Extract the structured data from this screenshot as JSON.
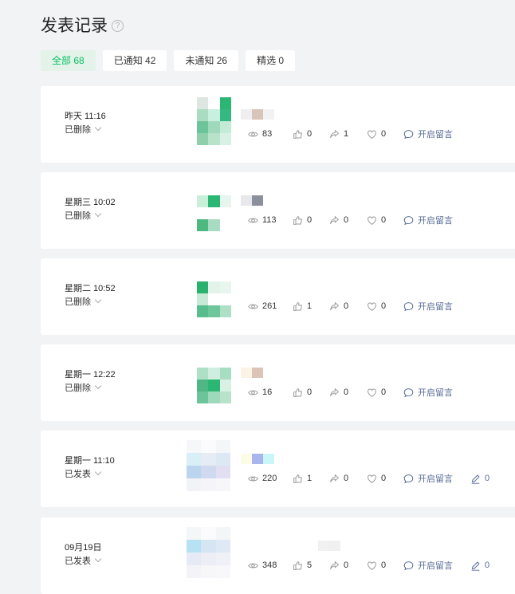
{
  "page": {
    "title": "发表记录"
  },
  "filters": [
    {
      "label": "全部 68",
      "active": true
    },
    {
      "label": "已通知 42",
      "active": false
    },
    {
      "label": "未通知 26",
      "active": false
    },
    {
      "label": "精选 0",
      "active": false
    }
  ],
  "records": [
    {
      "time": "昨天 11:16",
      "status": "已删除",
      "views": "83",
      "likes": "0",
      "shares": "1",
      "favorites": "0",
      "comment_label": "开启留言",
      "edits": null
    },
    {
      "time": "星期三 10:02",
      "status": "已删除",
      "views": "113",
      "likes": "0",
      "shares": "0",
      "favorites": "0",
      "comment_label": "开启留言",
      "edits": null
    },
    {
      "time": "星期二 10:52",
      "status": "已删除",
      "views": "261",
      "likes": "1",
      "shares": "0",
      "favorites": "0",
      "comment_label": "开启留言",
      "edits": null
    },
    {
      "time": "星期一 12:22",
      "status": "已删除",
      "views": "16",
      "likes": "0",
      "shares": "0",
      "favorites": "0",
      "comment_label": "开启留言",
      "edits": null
    },
    {
      "time": "星期一 11:10",
      "status": "已发表",
      "views": "220",
      "likes": "1",
      "shares": "0",
      "favorites": "0",
      "comment_label": "开启留言",
      "edits": "0"
    },
    {
      "time": "09月19日",
      "status": "已发表",
      "views": "348",
      "likes": "5",
      "shares": "0",
      "favorites": "0",
      "comment_label": "开启留言",
      "edits": "0"
    }
  ],
  "icons": {
    "views": "eye-icon",
    "likes": "thumb-up-icon",
    "shares": "share-icon",
    "favorites": "heart-icon",
    "comments": "comment-icon",
    "edits": "pencil-icon",
    "help": "help-icon",
    "status": "chevron-down-icon"
  },
  "colors": {
    "accent": "#07c160",
    "link": "#576b95",
    "background": "#f2f3f5"
  }
}
